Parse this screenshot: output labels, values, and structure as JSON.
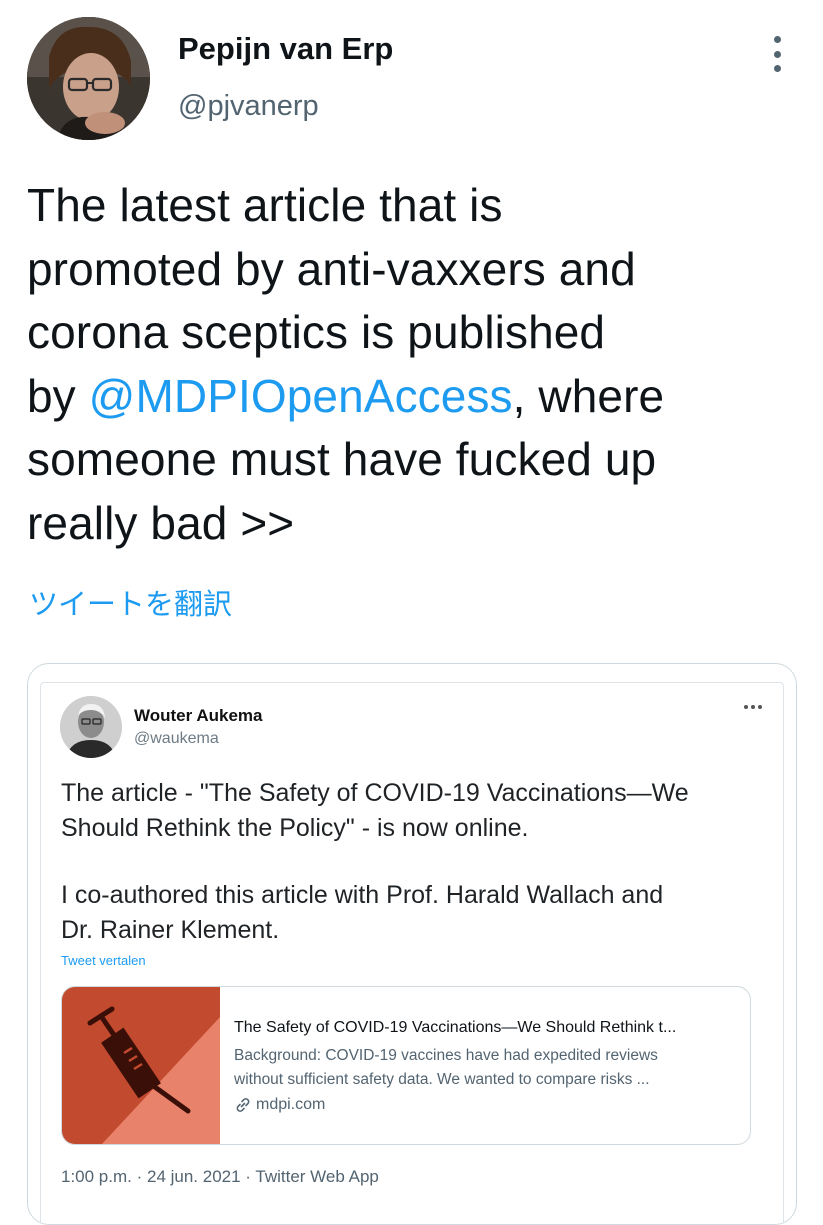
{
  "tweet": {
    "author": {
      "name": "Pepijn van Erp",
      "handle": "@pjvanerp"
    },
    "lines": [
      {
        "text": "The latest article that is"
      },
      {
        "text": "promoted by anti-vaxxers and"
      },
      {
        "text": "corona sceptics is published"
      },
      {
        "pre": "by ",
        "mention": "@MDPIOpenAccess",
        "post": ", where"
      },
      {
        "text": "someone must have fucked up"
      },
      {
        "text": "really bad >>"
      }
    ],
    "translate_label": "ツイートを翻訳",
    "more_icon": "more-vertical-icon"
  },
  "quoted": {
    "author": {
      "name": "Wouter Aukema",
      "handle": "@waukema"
    },
    "paragraph1_lines": [
      "The article - \"The Safety of COVID-19 Vaccinations—We",
      "Should Rethink the Policy\" - is now online."
    ],
    "paragraph2_lines": [
      "I co-authored this article with Prof. Harald Wallach and",
      "Dr. Rainer Klement."
    ],
    "translate_label": "Tweet vertalen",
    "link_card": {
      "title": "The Safety of COVID-19 Vaccinations—We Should Rethink t...",
      "description_lines": [
        "Background: COVID-19 vaccines have had expedited reviews",
        "without sufficient safety data. We wanted to compare risks ..."
      ],
      "domain": "mdpi.com",
      "thumbnail_icon": "syringe-icon",
      "thumbnail_colors": {
        "dark": "#c24a2e",
        "light": "#e8826a",
        "icon": "#3a0f08"
      }
    },
    "meta": {
      "time": "1:00 p.m.",
      "date": "24 jun. 2021",
      "source": "Twitter Web App"
    }
  },
  "colors": {
    "accent": "#1d9bf0",
    "text": "#0f1419",
    "muted": "#536471",
    "border": "#cfd9de"
  }
}
